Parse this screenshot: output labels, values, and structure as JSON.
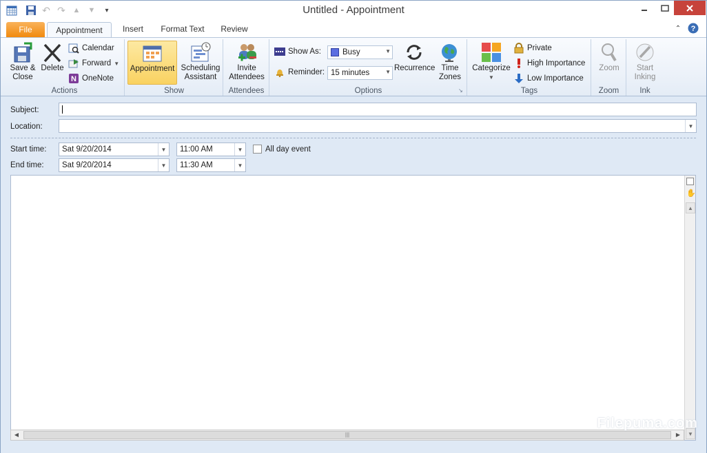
{
  "window": {
    "title": "Untitled  -  Appointment"
  },
  "tabs": [
    {
      "label": "File"
    },
    {
      "label": "Appointment"
    },
    {
      "label": "Insert"
    },
    {
      "label": "Format Text"
    },
    {
      "label": "Review"
    }
  ],
  "ribbon": {
    "actions": {
      "label": "Actions",
      "save_close": "Save &\nClose",
      "delete": "Delete",
      "calendar": "Calendar",
      "forward": "Forward",
      "onenote": "OneNote"
    },
    "show": {
      "label": "Show",
      "appointment": "Appointment",
      "scheduling": "Scheduling\nAssistant"
    },
    "attendees": {
      "label": "Attendees",
      "invite": "Invite\nAttendees"
    },
    "options": {
      "label": "Options",
      "show_as_label": "Show As:",
      "show_as_value": "Busy",
      "reminder_label": "Reminder:",
      "reminder_value": "15 minutes",
      "recurrence": "Recurrence",
      "time_zones": "Time\nZones"
    },
    "tags": {
      "label": "Tags",
      "categorize": "Categorize",
      "private": "Private",
      "high_importance": "High Importance",
      "low_importance": "Low Importance"
    },
    "zoom": {
      "label": "Zoom",
      "zoom": "Zoom"
    },
    "ink": {
      "label": "Ink",
      "start_inking": "Start\nInking"
    }
  },
  "form": {
    "subject_label": "Subject:",
    "subject_value": "",
    "location_label": "Location:",
    "location_value": "",
    "start_label": "Start time:",
    "start_date": "Sat 9/20/2014",
    "start_time": "11:00 AM",
    "all_day_label": "All day event",
    "end_label": "End time:",
    "end_date": "Sat 9/20/2014",
    "end_time": "11:30 AM"
  },
  "watermark": "Filepuma.com",
  "colors": {
    "file_tab": "#f18a0e",
    "ribbon_bg": "#e4ecf6",
    "form_bg": "#dfe9f5",
    "busy": "#5b6ee1"
  }
}
